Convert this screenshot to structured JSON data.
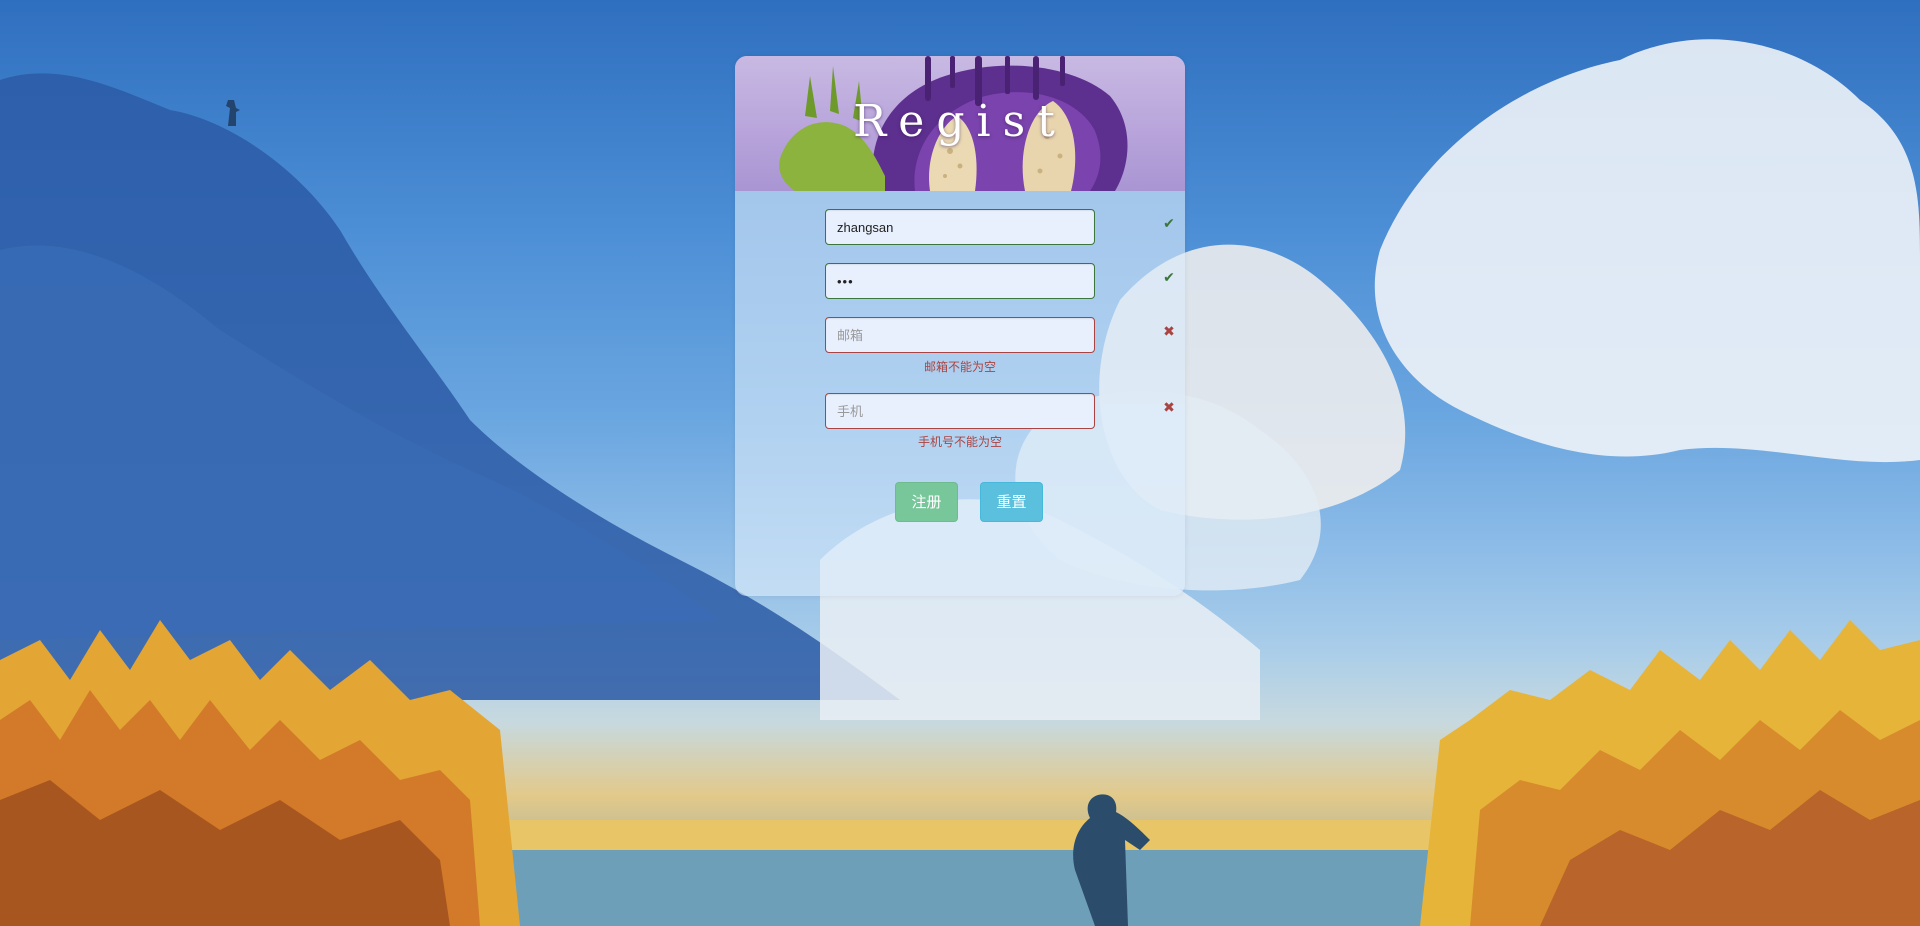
{
  "banner": {
    "title": "Regist"
  },
  "form": {
    "username": {
      "value": "zhangsan",
      "status": "valid"
    },
    "password": {
      "value": "•••",
      "status": "valid"
    },
    "email": {
      "value": "",
      "placeholder": "邮箱",
      "status": "invalid",
      "error": "邮箱不能为空"
    },
    "phone": {
      "value": "",
      "placeholder": "手机",
      "status": "invalid",
      "error": "手机号不能为空"
    }
  },
  "icons": {
    "valid": "✔",
    "invalid": "✖"
  },
  "buttons": {
    "register_label": "注册",
    "reset_label": "重置"
  },
  "colors": {
    "valid": "#3c763d",
    "invalid": "#a94442",
    "register_button": "#78c79a",
    "reset_button": "#5bc0de"
  }
}
